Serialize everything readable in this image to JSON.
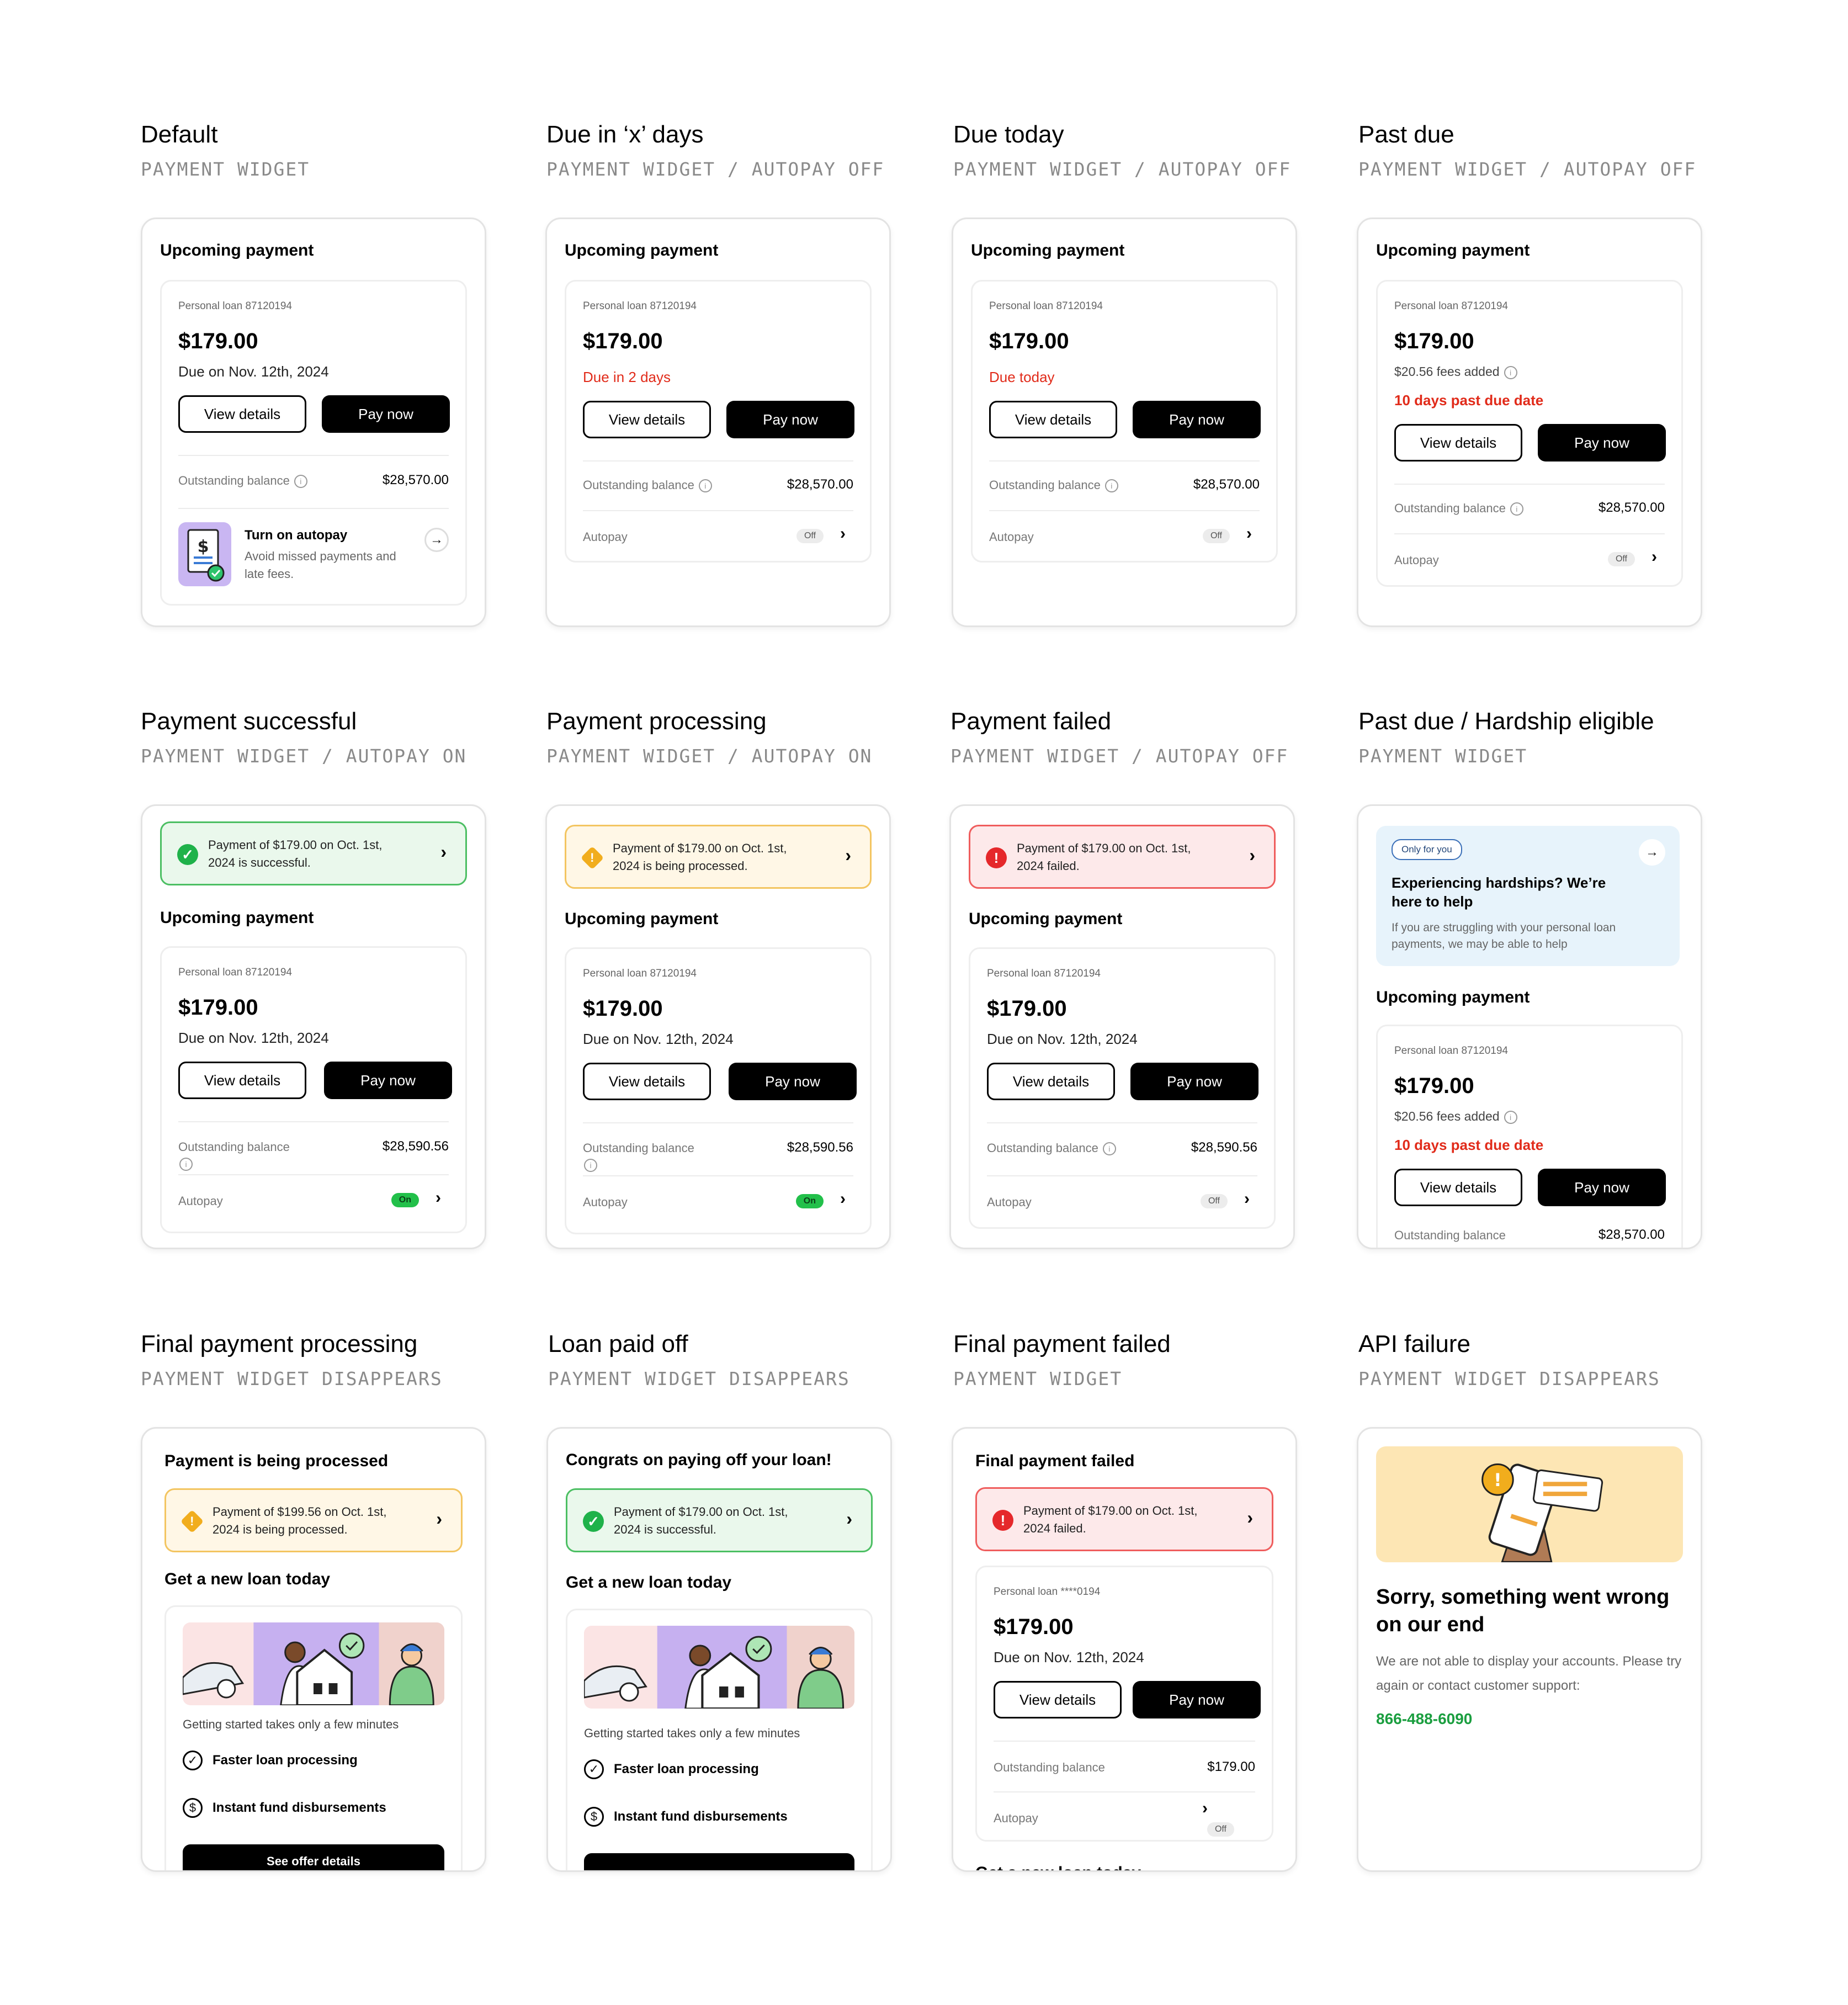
{
  "labels": {
    "upcoming": "Upcoming payment",
    "loan": "Personal loan 87120194",
    "loan_masked": "Personal loan ****0194",
    "amount": "$179.00",
    "due_date": "Due on Nov. 12th, 2024",
    "view": "View details",
    "pay": "Pay now",
    "outstanding": "Outstanding balance",
    "autopay": "Autopay",
    "off": "Off",
    "on": "On",
    "fees": "$20.56 fees added",
    "past_due": "10 days past due date",
    "bal1": "$28,570.00",
    "bal2": "$28,590.56",
    "bal3": "$179.00",
    "new_loan": "Get a new loan today",
    "getting_started": "Getting started takes only a few minutes",
    "faster": "Faster loan processing",
    "instant": "Instant fund disbursements",
    "see_offer": "See offer details"
  },
  "c1": {
    "title": "Default",
    "sub": "PAYMENT WIDGET",
    "autopay_title": "Turn on autopay",
    "autopay_desc": "Avoid missed payments and late fees."
  },
  "c2": {
    "title": "Due in ‘x’ days",
    "sub": "PAYMENT WIDGET / AUTOPAY OFF",
    "status": "Due in 2 days"
  },
  "c3": {
    "title": "Due today",
    "sub": "PAYMENT WIDGET / AUTOPAY OFF",
    "status": "Due today"
  },
  "c4": {
    "title": "Past due",
    "sub": "PAYMENT WIDGET / AUTOPAY OFF"
  },
  "c5": {
    "title": "Payment successful",
    "sub": "PAYMENT WIDGET / AUTOPAY ON",
    "alert": "Payment of $179.00 on Oct. 1st, 2024 is successful."
  },
  "c6": {
    "title": "Payment processing",
    "sub": "PAYMENT WIDGET / AUTOPAY ON",
    "alert": "Payment of $179.00 on Oct. 1st, 2024 is being processed."
  },
  "c7": {
    "title": "Payment failed",
    "sub": "PAYMENT WIDGET / AUTOPAY OFF",
    "alert": "Payment of $179.00 on Oct. 1st, 2024 failed."
  },
  "c8": {
    "title": "Past due / Hardship eligible",
    "sub": "PAYMENT WIDGET",
    "tag": "Only for you",
    "h_title": "Experiencing hardships? We’re here to help",
    "h_desc": "If you are struggling with your personal loan payments, we may be able to help"
  },
  "c9": {
    "title": "Final payment processing",
    "sub": "PAYMENT WIDGET DISAPPEARS",
    "header": "Payment is being processed",
    "alert": "Payment of $199.56 on Oct. 1st, 2024 is being processed."
  },
  "c10": {
    "title": "Loan paid off",
    "sub": "PAYMENT WIDGET DISAPPEARS",
    "header": "Congrats on paying off your loan!",
    "alert": "Payment of $179.00 on Oct. 1st, 2024 is successful."
  },
  "c11": {
    "title": "Final payment failed",
    "sub": "PAYMENT WIDGET",
    "header": "Final payment failed",
    "alert": "Payment of $179.00 on Oct. 1st, 2024 failed."
  },
  "c12": {
    "title": "API failure",
    "sub": "PAYMENT WIDGET DISAPPEARS",
    "err_title": "Sorry, something went wrong on our end",
    "err_desc": "We are not able to display your accounts. Please try again or contact customer support:",
    "phone": "866-488-6090"
  },
  "colors": {
    "red": "#e12b1a",
    "green": "#1fb24a",
    "phone_green": "#1a9e3f",
    "yellow": "#f1ad1d"
  }
}
